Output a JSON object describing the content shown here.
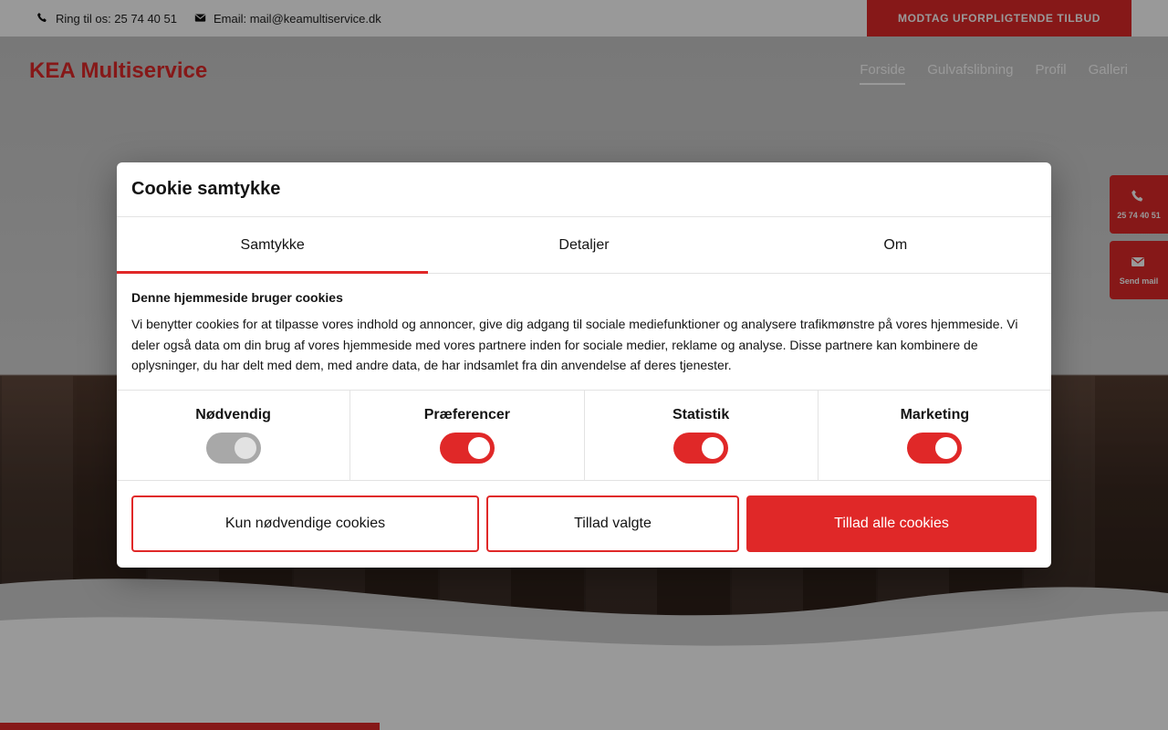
{
  "topbar": {
    "phone_text": "Ring til os: 25 74 40 51",
    "email_text": "Email: mail@keamultiservice.dk",
    "cta_label": "MODTAG UFORPLIGTENDE TILBUD"
  },
  "header": {
    "logo": "KEA Multiservice",
    "nav": [
      {
        "label": "Forside",
        "active": true
      },
      {
        "label": "Gulvafslibning",
        "active": false
      },
      {
        "label": "Profil",
        "active": false
      },
      {
        "label": "Galleri",
        "active": false
      }
    ]
  },
  "floating": {
    "call_label": "25 74 40 51",
    "mail_label": "Send mail"
  },
  "cookie_dialog": {
    "title": "Cookie samtykke",
    "tabs": [
      {
        "label": "Samtykke",
        "active": true
      },
      {
        "label": "Detaljer",
        "active": false
      },
      {
        "label": "Om",
        "active": false
      }
    ],
    "heading": "Denne hjemmeside bruger cookies",
    "text": "Vi benytter cookies for at tilpasse vores indhold og annoncer, give dig adgang til sociale mediefunktioner og analysere trafikmønstre på vores hjemmeside. Vi deler også data om din brug af vores hjemmeside med vores partnere inden for sociale medier, reklame og analyse. Disse partnere kan kombinere de oplysninger, du har delt med dem, med andre data, de har indsamlet fra din anvendelse af deres tjenester.",
    "toggles": [
      {
        "label": "Nødvendig",
        "on": true,
        "disabled": true
      },
      {
        "label": "Præferencer",
        "on": true,
        "disabled": false
      },
      {
        "label": "Statistik",
        "on": true,
        "disabled": false
      },
      {
        "label": "Marketing",
        "on": true,
        "disabled": false
      }
    ],
    "buttons": {
      "necessary_only": "Kun nødvendige cookies",
      "allow_selected": "Tillad valgte",
      "allow_all": "Tillad alle cookies"
    }
  },
  "colors": {
    "accent": "#e02828",
    "toggle_disabled": "#a8a8a8"
  },
  "icons": {
    "phone": "phone-icon",
    "email": "envelope-icon"
  }
}
